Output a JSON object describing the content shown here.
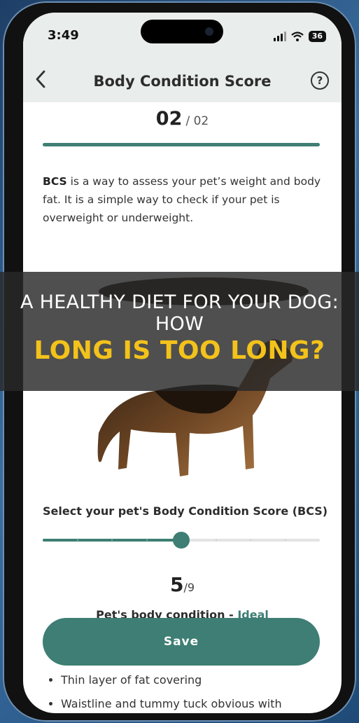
{
  "status": {
    "time": "3:49",
    "battery": "36"
  },
  "appbar": {
    "title": "Body Condition Score",
    "back_icon": "chevron-left-icon",
    "help_icon": "question-circle-icon"
  },
  "step": {
    "current": "02",
    "separator": "/ 02"
  },
  "description": {
    "bold": "BCS",
    "text": " is a way to assess your pet’s weight and body fat. It is a simple way to check if your pet is overweight or underweight."
  },
  "overlay": {
    "line1": "A HEALTHY DIET FOR YOUR DOG: HOW",
    "line2": "LONG IS TOO LONG?"
  },
  "bcs": {
    "label": "Select your pet's Body Condition Score (BCS)",
    "value": 5,
    "max": 9,
    "value_text": "5",
    "max_text": "/9",
    "condition_prefix": "Pet's body condition - ",
    "condition": "Ideal"
  },
  "save_label": "Save",
  "bullets": [
    "Thin layer of fat covering",
    "Waistline and tummy tuck obvious with"
  ],
  "colors": {
    "accent": "#3e7e74",
    "header": "#e9edeb",
    "overlay_title": "#f3c21b"
  }
}
